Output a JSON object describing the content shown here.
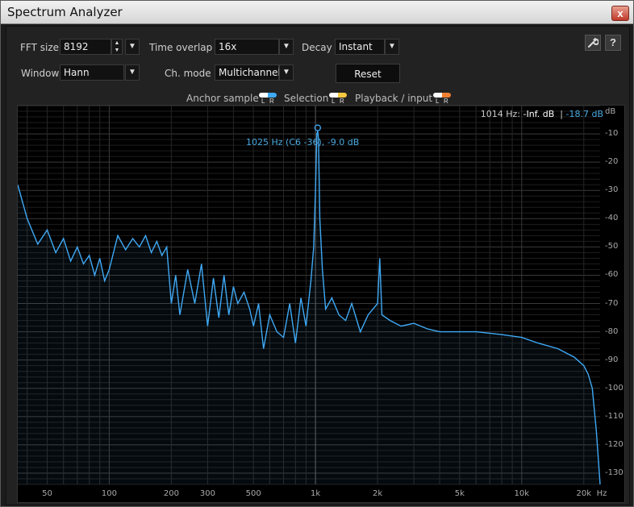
{
  "window": {
    "title": "Spectrum Analyzer",
    "close_glyph": "x"
  },
  "controls": {
    "fft_size": {
      "label": "FFT size",
      "value": "8192"
    },
    "time_overlap": {
      "label": "Time overlap",
      "value": "16x"
    },
    "decay": {
      "label": "Decay",
      "value": "Instant"
    },
    "window": {
      "label": "Window",
      "value": "Hann"
    },
    "ch_mode": {
      "label": "Ch. mode",
      "value": "Multichannel"
    },
    "reset_label": "Reset",
    "settings_icon": "wrench-icon",
    "help_glyph": "?"
  },
  "legend": {
    "anchor_sample": {
      "label": "Anchor sample",
      "color": "#3fa9f5"
    },
    "selection": {
      "label": "Selection",
      "color": "#f5c842"
    },
    "playback_input": {
      "label": "Playback / input",
      "color": "#f08030"
    },
    "l": "L",
    "r": "R"
  },
  "readout": {
    "freq": "1014 Hz:",
    "value1": "-Inf. dB",
    "sep": "|",
    "value2": "-18.7 dB",
    "peak": "1025 Hz (C6 -36), -9.0 dB"
  },
  "chart_data": {
    "type": "line",
    "title": "",
    "xlabel": "Hz",
    "ylabel": "dB",
    "x_scale": "log",
    "xlim": [
      36,
      24000
    ],
    "ylim": [
      -134,
      0
    ],
    "grid": true,
    "line_color": "#3fa9f5",
    "x_ticks": [
      "50",
      "100",
      "200",
      "300",
      "500",
      "1k",
      "2k",
      "5k",
      "10k",
      "20k",
      "Hz"
    ],
    "y_ticks": [
      "dB",
      "-10",
      "-20",
      "-30",
      "-40",
      "-50",
      "-60",
      "-70",
      "-80",
      "-90",
      "-100",
      "-110",
      "-120",
      "-130"
    ],
    "series": [
      {
        "x": [
          36,
          40,
          45,
          50,
          55,
          60,
          65,
          70,
          75,
          80,
          85,
          90,
          95,
          100,
          110,
          120,
          130,
          140,
          150,
          160,
          170,
          180,
          190,
          200,
          210,
          220,
          240,
          260,
          280,
          300,
          320,
          340,
          360,
          380,
          400,
          420,
          450,
          480,
          500,
          530,
          560,
          600,
          650,
          700,
          750,
          800,
          850,
          900,
          950,
          980,
          1000,
          1015,
          1025,
          1035,
          1050,
          1080,
          1120,
          1200,
          1300,
          1400,
          1500,
          1650,
          1800,
          2000,
          2050,
          2100,
          2300,
          2600,
          3000,
          3500,
          4000,
          5000,
          6000,
          8000,
          10000,
          12000,
          15000,
          18000,
          20000,
          21000,
          22000,
          23000,
          24000
        ],
        "y": [
          -28,
          -40,
          -49,
          -44,
          -52,
          -47,
          -55,
          -50,
          -56,
          -53,
          -60,
          -54,
          -62,
          -58,
          -46,
          -51,
          -47,
          -50,
          -46,
          -52,
          -48,
          -53,
          -50,
          -70,
          -60,
          -74,
          -58,
          -70,
          -56,
          -78,
          -61,
          -75,
          -60,
          -74,
          -64,
          -70,
          -66,
          -72,
          -78,
          -70,
          -86,
          -74,
          -80,
          -82,
          -70,
          -84,
          -68,
          -78,
          -62,
          -50,
          -30,
          -10,
          -9,
          -12,
          -40,
          -58,
          -72,
          -68,
          -74,
          -76,
          -70,
          -80,
          -74,
          -70,
          -54,
          -74,
          -76,
          -78,
          -77,
          -79,
          -80,
          -80,
          -80,
          -81,
          -82,
          -84,
          -86,
          -89,
          -92,
          -95,
          -100,
          -115,
          -134
        ]
      }
    ]
  }
}
